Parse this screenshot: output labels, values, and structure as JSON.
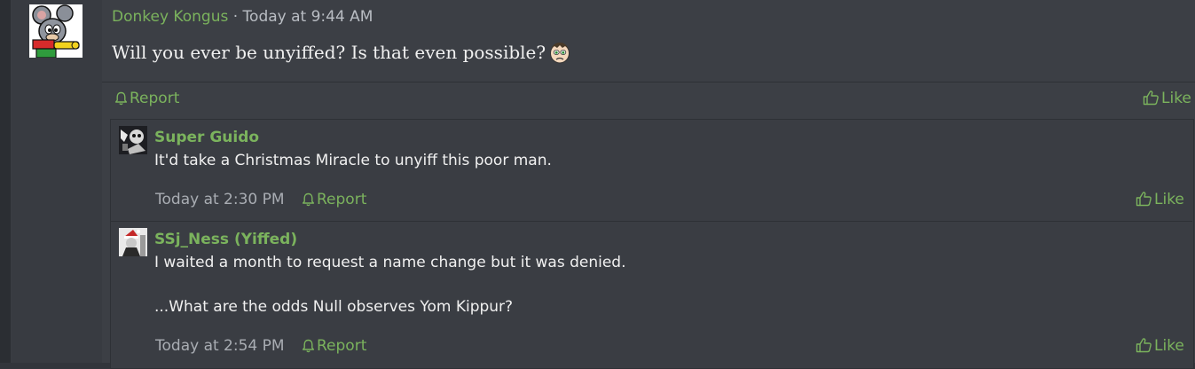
{
  "post": {
    "author": "Donkey Kongus",
    "separator": "·",
    "time": "Today at 9:44 AM",
    "text": "Will you ever be unyiffed? Is that even possible?",
    "smiley": "sad-face-icon",
    "report_label": "Report",
    "like_label": "Like"
  },
  "comments": [
    {
      "author": "Super Guido",
      "lines": [
        "It'd take a Christmas Miracle to unyiff this poor man."
      ],
      "time": "Today at 2:30 PM",
      "report_label": "Report",
      "like_label": "Like"
    },
    {
      "author": "SSj_Ness (Yiffed)",
      "lines": [
        "I waited a month to request a name change but it was denied.",
        "...What are the odds Null observes Yom Kippur?"
      ],
      "time": "Today at 2:54 PM",
      "report_label": "Report",
      "like_label": "Like"
    }
  ],
  "colors": {
    "accent": "#7bb35d",
    "background": "#3c3f45",
    "text": "#f0f0f0",
    "muted": "#a9adb3"
  },
  "icons": [
    "bell-icon",
    "thumbs-up-icon"
  ]
}
